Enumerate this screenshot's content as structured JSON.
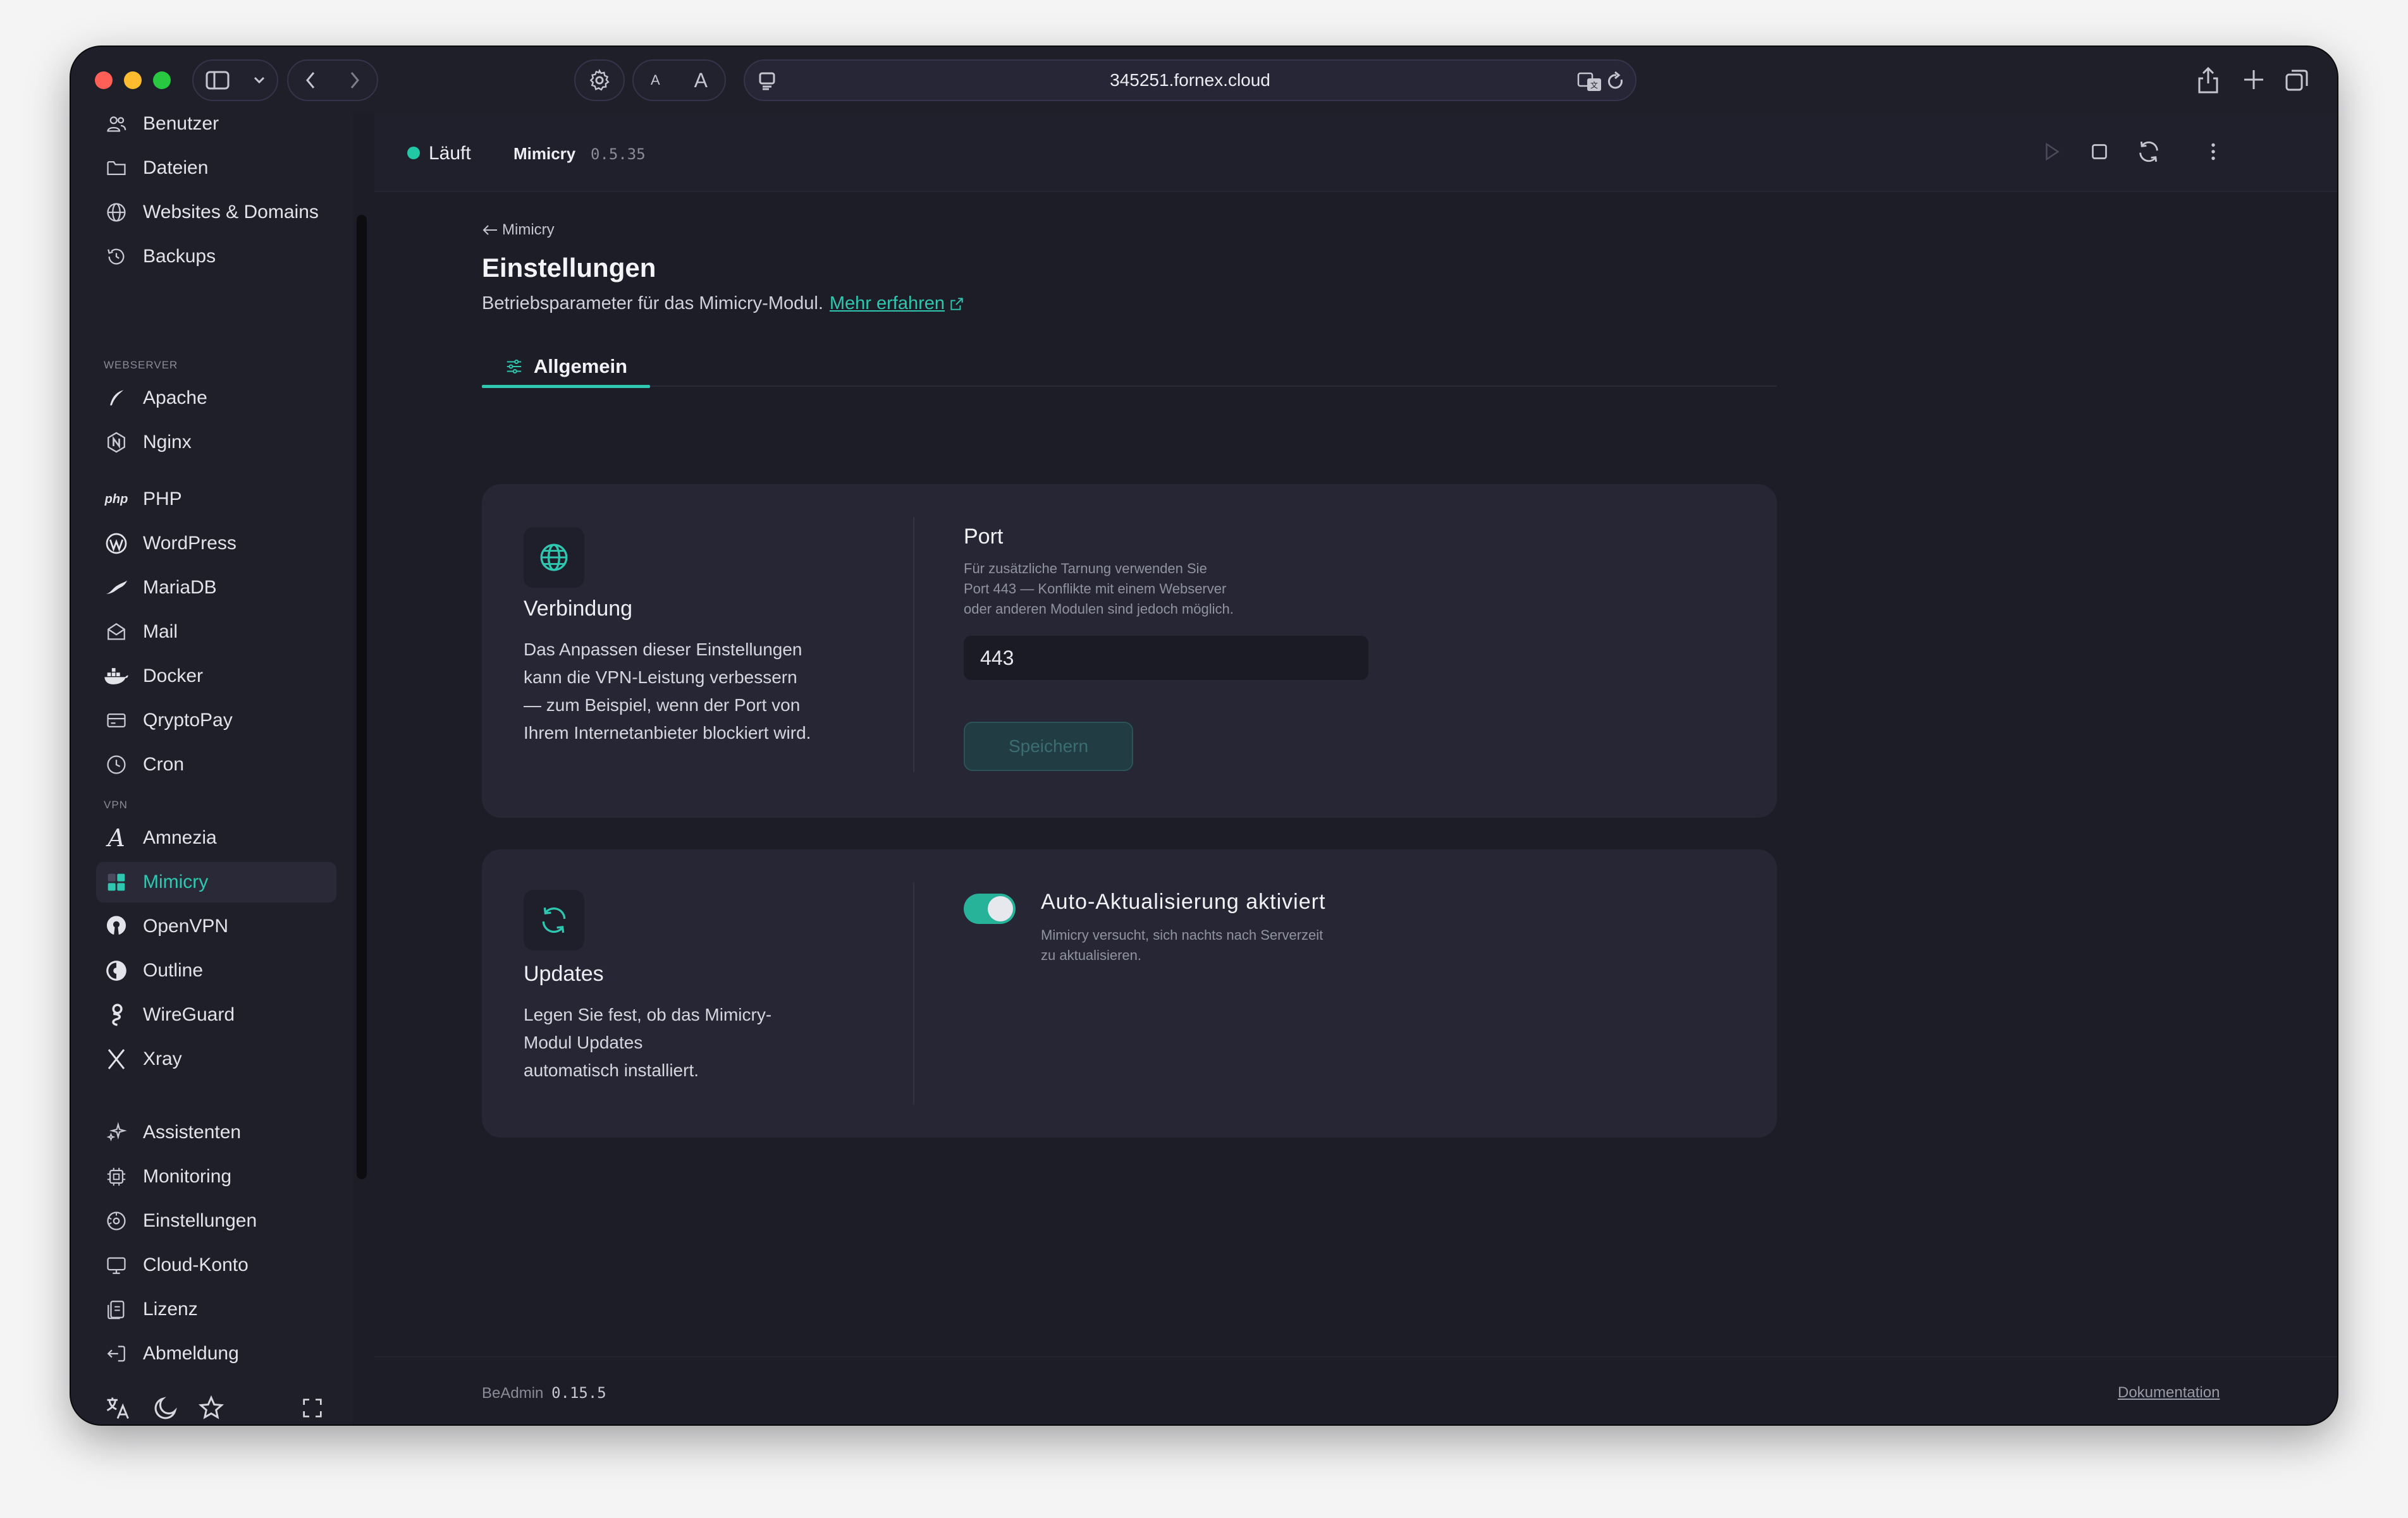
{
  "browser": {
    "url": "345251.fornex.cloud",
    "font_small": "A",
    "font_large": "A"
  },
  "sidebar": {
    "items_top": [
      {
        "label": "Benutzer",
        "icon": "users-icon"
      },
      {
        "label": "Dateien",
        "icon": "folder-icon"
      },
      {
        "label": "Websites & Domains",
        "icon": "globe-icon"
      },
      {
        "label": "Backups",
        "icon": "history-icon"
      }
    ],
    "group_webserver": "WEBSERVER",
    "items_webserver": [
      {
        "label": "Apache",
        "icon": "feather-icon"
      },
      {
        "label": "Nginx",
        "icon": "nginx-icon"
      }
    ],
    "php_logo": "php",
    "items_services": [
      {
        "label": "PHP",
        "icon": "php-icon"
      },
      {
        "label": "WordPress",
        "icon": "wordpress-icon"
      },
      {
        "label": "MariaDB",
        "icon": "mariadb-icon"
      },
      {
        "label": "Mail",
        "icon": "mail-icon"
      },
      {
        "label": "Docker",
        "icon": "docker-icon"
      },
      {
        "label": "QryptoPay",
        "icon": "card-icon"
      },
      {
        "label": "Cron",
        "icon": "clock-icon"
      }
    ],
    "group_vpn": "VPN",
    "items_vpn": [
      {
        "label": "Amnezia",
        "icon": "amnezia-icon"
      },
      {
        "label": "Mimicry",
        "icon": "mimicry-icon"
      },
      {
        "label": "OpenVPN",
        "icon": "openvpn-icon"
      },
      {
        "label": "Outline",
        "icon": "outline-icon"
      },
      {
        "label": "WireGuard",
        "icon": "wireguard-icon"
      },
      {
        "label": "Xray",
        "icon": "xray-icon"
      }
    ],
    "items_bottom": [
      {
        "label": "Assistenten",
        "icon": "sparkles-icon"
      },
      {
        "label": "Monitoring",
        "icon": "cpu-icon"
      },
      {
        "label": "Einstellungen",
        "icon": "settings-icon"
      },
      {
        "label": "Cloud-Konto",
        "icon": "monitor-icon"
      },
      {
        "label": "Lizenz",
        "icon": "license-icon"
      },
      {
        "label": "Abmeldung",
        "icon": "logout-icon"
      }
    ]
  },
  "topbar": {
    "status": "Läuft",
    "module_name": "Mimicry",
    "module_version": "0.5.35"
  },
  "page": {
    "breadcrumb": "Mimicry",
    "title": "Einstellungen",
    "subtitle": "Betriebsparameter für das Mimicry-Modul.",
    "learn_more": "Mehr erfahren",
    "tab": "Allgemein"
  },
  "connection": {
    "title": "Verbindung",
    "description_lines": [
      "Das Anpassen dieser Einstellungen",
      "kann die VPN-Leistung verbessern",
      "— zum Beispiel, wenn der Port von",
      "Ihrem Internetanbieter blockiert wird."
    ],
    "port_label": "Port",
    "port_help_lines": [
      "Für zusätzliche Tarnung verwenden Sie",
      "Port 443 — Konflikte mit einem Webserver",
      "oder anderen Modulen sind jedoch möglich."
    ],
    "port_value": "443",
    "save_label": "Speichern"
  },
  "updates": {
    "title": "Updates",
    "description_lines": [
      "Legen Sie fest, ob das Mimicry-",
      "Modul Updates",
      "automatisch installiert."
    ],
    "toggle_label": "Auto-Aktualisierung aktiviert",
    "toggle_on": true,
    "toggle_help_lines": [
      "Mimicry versucht, sich nachts nach Serverzeit",
      "zu aktualisieren."
    ]
  },
  "footer": {
    "app_name": "BeAdmin",
    "app_version": "0.15.5",
    "docs_link": "Dokumentation"
  },
  "colors": {
    "accent": "#2fc7b0",
    "status_running": "#22c7a3",
    "background": "#1d1d27",
    "card": "#262634"
  }
}
